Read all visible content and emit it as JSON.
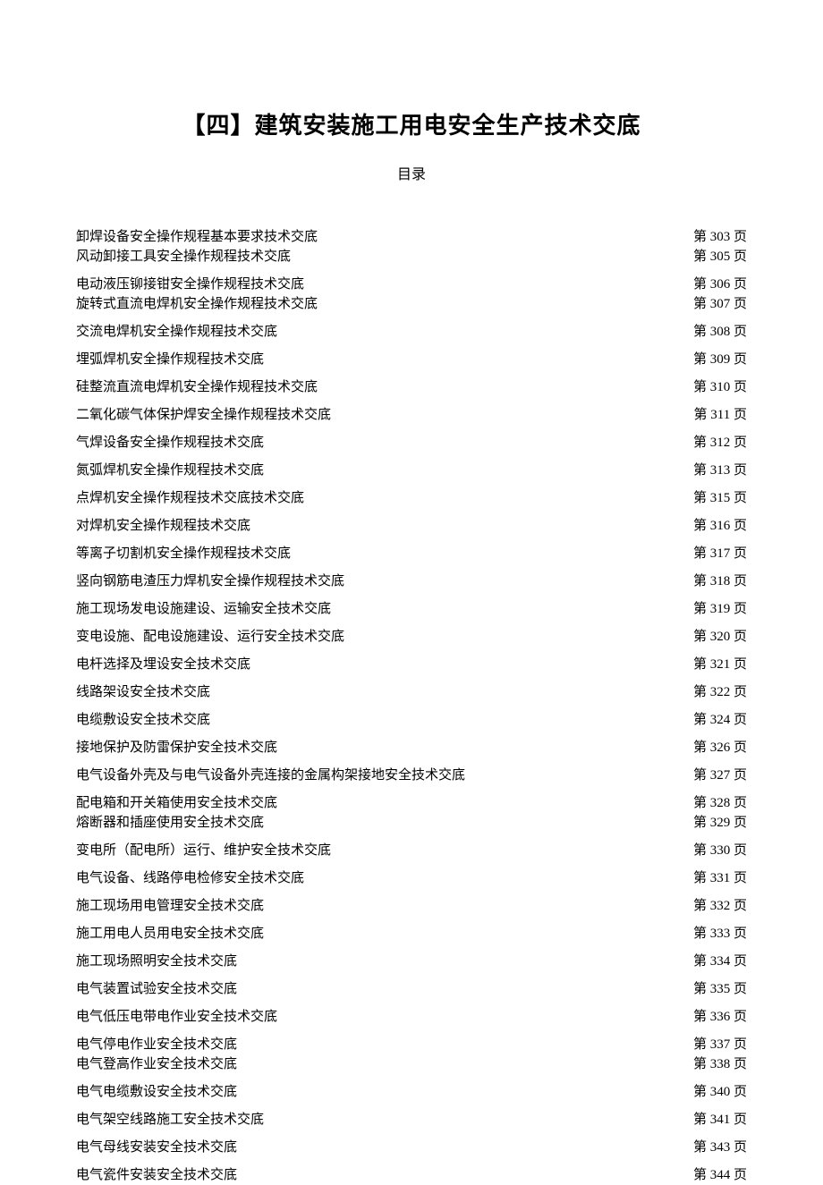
{
  "header": {
    "title": "【四】建筑安装施工用电安全生产技术交底",
    "subtitle": "目录"
  },
  "toc": [
    {
      "title": "卸焊设备安全操作规程基本要求技术交底",
      "page": "第 303 页",
      "tight": false
    },
    {
      "title": "风动卸接工具安全操作规程技术交底",
      "page": "第 305 页",
      "tight": true
    },
    {
      "title": "电动液压铆接钳安全操作规程技术交底",
      "page": "第 306 页",
      "tight": false
    },
    {
      "title": "旋转式直流电焊机安全操作规程技术交底",
      "page": "第 307 页",
      "tight": true
    },
    {
      "title": "交流电焊机安全操作规程技术交底",
      "page": "第 308 页",
      "tight": false
    },
    {
      "title": "埋弧焊机安全操作规程技术交底",
      "page": "第 309 页",
      "tight": false
    },
    {
      "title": "硅整流直流电焊机安全操作规程技术交底",
      "page": "第 310 页",
      "tight": false
    },
    {
      "title": "二氧化碳气体保护焊安全操作规程技术交底",
      "page": "第 311 页",
      "tight": false
    },
    {
      "title": "气焊设备安全操作规程技术交底",
      "page": "第 312 页",
      "tight": false
    },
    {
      "title": "氮弧焊机安全操作规程技术交底",
      "page": "第 313 页",
      "tight": false
    },
    {
      "title": "点焊机安全操作规程技术交底技术交底",
      "page": "第 315 页",
      "tight": false
    },
    {
      "title": "对焊机安全操作规程技术交底",
      "page": "第 316 页",
      "tight": false
    },
    {
      "title": "等离子切割机安全操作规程技术交底",
      "page": "第 317 页",
      "tight": false
    },
    {
      "title": "竖向钢筋电渣压力焊机安全操作规程技术交底",
      "page": "第 318 页",
      "tight": false
    },
    {
      "title": "施工现场发电设施建设、运输安全技术交底",
      "page": "第 319 页",
      "tight": false
    },
    {
      "title": "变电设施、配电设施建设、运行安全技术交底",
      "page": "第 320 页",
      "tight": false
    },
    {
      "title": "电杆选择及埋设安全技术交底",
      "page": "第 321 页",
      "tight": false
    },
    {
      "title": "线路架设安全技术交底",
      "page": "第 322 页",
      "tight": false
    },
    {
      "title": "电缆敷设安全技术交底",
      "page": "第 324 页",
      "tight": false
    },
    {
      "title": "接地保护及防雷保护安全技术交底",
      "page": "第 326 页",
      "tight": false
    },
    {
      "title": "电气设备外壳及与电气设备外壳连接的金属构架接地安全技术交底",
      "page": "第 327 页",
      "tight": false
    },
    {
      "title": "配电箱和开关箱使用安全技术交底",
      "page": "第 328 页",
      "tight": false
    },
    {
      "title": "熔断器和插座使用安全技术交底",
      "page": "第 329 页",
      "tight": true
    },
    {
      "title": "变电所（配电所）运行、维护安全技术交底",
      "page": "第 330 页",
      "tight": false
    },
    {
      "title": "电气设备、线路停电检修安全技术交底",
      "page": "第 331 页",
      "tight": false
    },
    {
      "title": "施工现场用电管理安全技术交底",
      "page": "第 332 页",
      "tight": false
    },
    {
      "title": "施工用电人员用电安全技术交底",
      "page": "第 333 页",
      "tight": false
    },
    {
      "title": "施工现场照明安全技术交底",
      "page": "第 334 页",
      "tight": false
    },
    {
      "title": "电气装置试验安全技术交底",
      "page": "第 335 页",
      "tight": false
    },
    {
      "title": "电气低压电带电作业安全技术交底",
      "page": "第 336 页",
      "tight": false
    },
    {
      "title": "电气停电作业安全技术交底",
      "page": "第 337 页",
      "tight": false
    },
    {
      "title": "电气登高作业安全技术交底",
      "page": "第 338 页",
      "tight": true
    },
    {
      "title": "电气电缆敷设安全技术交底",
      "page": "第 340 页",
      "tight": false
    },
    {
      "title": "电气架空线路施工安全技术交底",
      "page": "第 341 页",
      "tight": false
    },
    {
      "title": "电气母线安装安全技术交底",
      "page": "第 343 页",
      "tight": false
    },
    {
      "title": "电气瓷件安装安全技术交底",
      "page": "第 344 页",
      "tight": false
    }
  ]
}
